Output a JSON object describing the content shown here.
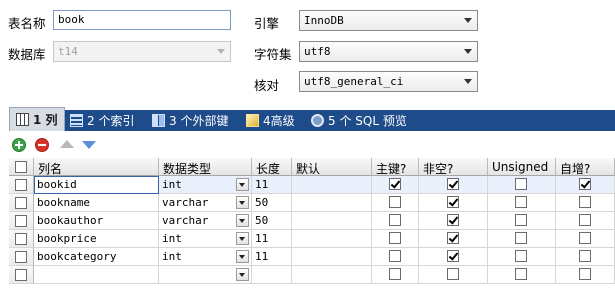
{
  "form": {
    "table_name_label": "表名称",
    "table_name_value": "book",
    "database_label": "数据库",
    "database_value": "t14",
    "engine_label": "引擎",
    "engine_value": "InnoDB",
    "charset_label": "字符集",
    "charset_value": "utf8",
    "collation_label": "核对",
    "collation_value": "utf8_general_ci"
  },
  "tabs": [
    {
      "label": "1 列",
      "icon": "columns-icon"
    },
    {
      "label": "2 个索引",
      "icon": "index-icon"
    },
    {
      "label": "3 个外部键",
      "icon": "foreign-key-icon"
    },
    {
      "label": "4高级",
      "icon": "advanced-icon"
    },
    {
      "label": "5 个 SQL 预览",
      "icon": "sql-preview-icon"
    }
  ],
  "toolbar": [
    "add-column-icon",
    "remove-column-icon",
    "move-up-icon",
    "move-down-icon"
  ],
  "grid": {
    "headers": [
      "列名",
      "数据类型",
      "长度",
      "默认",
      "主键?",
      "非空?",
      "Unsigned",
      "自增?"
    ],
    "rows": [
      {
        "name": "bookid",
        "type": "int",
        "length": "11",
        "default": "",
        "pk": true,
        "notnull": true,
        "unsigned": false,
        "autoinc": true
      },
      {
        "name": "bookname",
        "type": "varchar",
        "length": "50",
        "default": "",
        "pk": false,
        "notnull": true,
        "unsigned": false,
        "autoinc": false
      },
      {
        "name": "bookauthor",
        "type": "varchar",
        "length": "50",
        "default": "",
        "pk": false,
        "notnull": true,
        "unsigned": false,
        "autoinc": false
      },
      {
        "name": "bookprice",
        "type": "int",
        "length": "11",
        "default": "",
        "pk": false,
        "notnull": true,
        "unsigned": false,
        "autoinc": false
      },
      {
        "name": "bookcategory",
        "type": "int",
        "length": "11",
        "default": "",
        "pk": false,
        "notnull": true,
        "unsigned": false,
        "autoinc": false
      },
      {
        "name": "",
        "type": "",
        "length": "",
        "default": "",
        "pk": false,
        "notnull": false,
        "unsigned": false,
        "autoinc": false
      }
    ]
  },
  "colors": {
    "tab_bar": "#1e4b8a",
    "input_border": "#7a9cc6"
  }
}
